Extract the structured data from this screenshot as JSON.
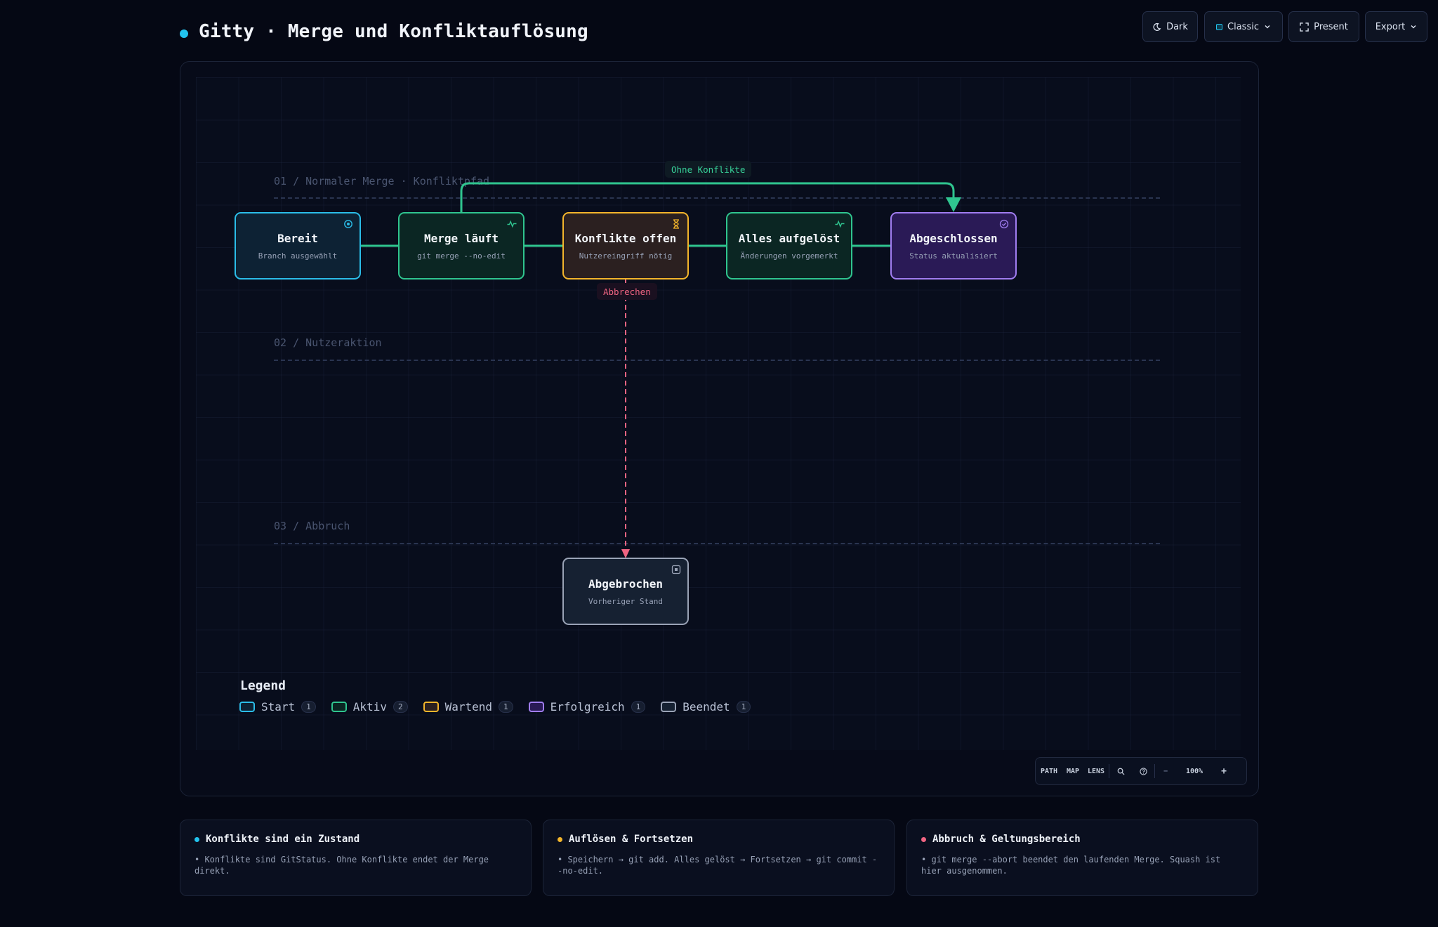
{
  "app": {
    "title": "Gitty · Merge und Konfliktauflösung",
    "accent": "#22c3ee"
  },
  "toolbar": {
    "theme_label": "Dark",
    "style_label": "Classic",
    "present_label": "Present",
    "export_label": "Export"
  },
  "lanes": [
    {
      "label": "01 / Normaler Merge · Konfliktpfad"
    },
    {
      "label": "02 / Nutzeraktion"
    },
    {
      "label": "03 / Abbruch"
    }
  ],
  "nodes": {
    "bereit": {
      "title": "Bereit",
      "subtitle": "Branch ausgewählt",
      "kind": "start",
      "icon": "target-icon"
    },
    "merge": {
      "title": "Merge läuft",
      "subtitle": "git merge --no-edit",
      "kind": "active",
      "icon": "pulse-icon"
    },
    "konflikte": {
      "title": "Konflikte offen",
      "subtitle": "Nutzereingriff nötig",
      "kind": "waiting",
      "icon": "hourglass-icon"
    },
    "aufgeloest": {
      "title": "Alles aufgelöst",
      "subtitle": "Änderungen vorgemerkt",
      "kind": "active",
      "icon": "pulse-icon"
    },
    "abgeschlossen": {
      "title": "Abgeschlossen",
      "subtitle": "Status aktualisiert",
      "kind": "success",
      "icon": "check-circle-icon"
    },
    "abgebrochen": {
      "title": "Abgebrochen",
      "subtitle": "Vorheriger Stand",
      "kind": "ended",
      "icon": "stop-square-icon"
    }
  },
  "edges": {
    "skip_label": "Ohne Konflikte",
    "abort_label": "Abbrechen"
  },
  "legend": {
    "title": "Legend",
    "items": [
      {
        "label": "Start",
        "count": "1",
        "color": "#2bbde8",
        "fill": "#0d2234"
      },
      {
        "label": "Aktiv",
        "count": "2",
        "color": "#2fc58f",
        "fill": "#0b2623"
      },
      {
        "label": "Wartend",
        "count": "1",
        "color": "#f3b52b",
        "fill": "#2b2020"
      },
      {
        "label": "Erfolgreich",
        "count": "1",
        "color": "#a07df0",
        "fill": "#2a1a56"
      },
      {
        "label": "Beendet",
        "count": "1",
        "color": "#9aa3b6",
        "fill": "#162132"
      }
    ]
  },
  "zoom": {
    "path_label": "PATH",
    "map_label": "MAP",
    "lens_label": "LENS",
    "minus_label": "−",
    "level": "100%",
    "plus_label": "+"
  },
  "cards": [
    {
      "title": "Konflikte sind ein Zustand",
      "body": "• Konflikte sind GitStatus. Ohne Konflikte endet der Merge direkt.",
      "color": "#22c3ee"
    },
    {
      "title": "Auflösen & Fortsetzen",
      "body": "• Speichern → git add. Alles gelöst → Fortsetzen → git commit --no-edit.",
      "color": "#f3b52b"
    },
    {
      "title": "Abbruch & Geltungsbereich",
      "body": "• git merge --abort beendet den laufenden Merge. Squash ist hier ausgenommen.",
      "color": "#f06482"
    }
  ]
}
